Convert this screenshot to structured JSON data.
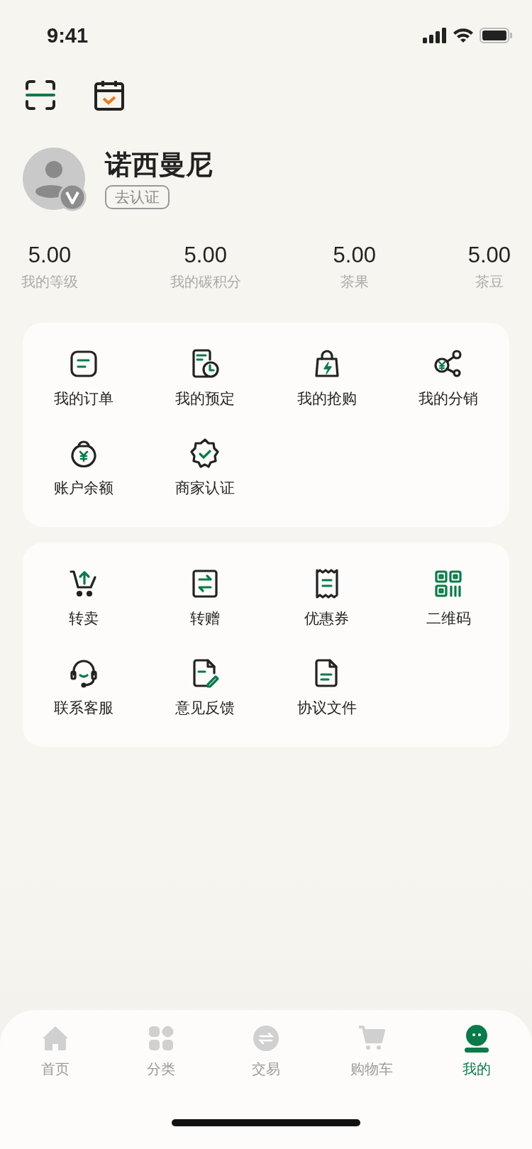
{
  "status_bar": {
    "time": "9:41"
  },
  "profile": {
    "name": "诺西曼尼",
    "verify_badge": "去认证"
  },
  "stats": [
    {
      "value": "5.00",
      "label": "我的等级"
    },
    {
      "value": "5.00",
      "label": "我的碳积分"
    },
    {
      "value": "5.00",
      "label": "茶果"
    },
    {
      "value": "5.00",
      "label": "茶豆"
    }
  ],
  "cards": [
    {
      "items": [
        {
          "kind": "order",
          "label": "我的订单"
        },
        {
          "kind": "reserve",
          "label": "我的预定"
        },
        {
          "kind": "flash",
          "label": "我的抢购"
        },
        {
          "kind": "share",
          "label": "我的分销"
        },
        {
          "kind": "balance",
          "label": "账户余额"
        },
        {
          "kind": "certify",
          "label": "商家认证"
        }
      ]
    },
    {
      "items": [
        {
          "kind": "resell",
          "label": "转卖"
        },
        {
          "kind": "transfer",
          "label": "转赠"
        },
        {
          "kind": "coupon",
          "label": "优惠券"
        },
        {
          "kind": "qrcode",
          "label": "二维码"
        },
        {
          "kind": "service",
          "label": "联系客服"
        },
        {
          "kind": "feedback",
          "label": "意见反馈"
        },
        {
          "kind": "document",
          "label": "协议文件"
        }
      ]
    }
  ],
  "tab_bar": [
    {
      "kind": "home",
      "label": "首页",
      "selected": false
    },
    {
      "kind": "category",
      "label": "分类",
      "selected": false
    },
    {
      "kind": "trade",
      "label": "交易",
      "selected": false
    },
    {
      "kind": "cart",
      "label": "购物车",
      "selected": false
    },
    {
      "kind": "mine",
      "label": "我的",
      "selected": true
    }
  ]
}
